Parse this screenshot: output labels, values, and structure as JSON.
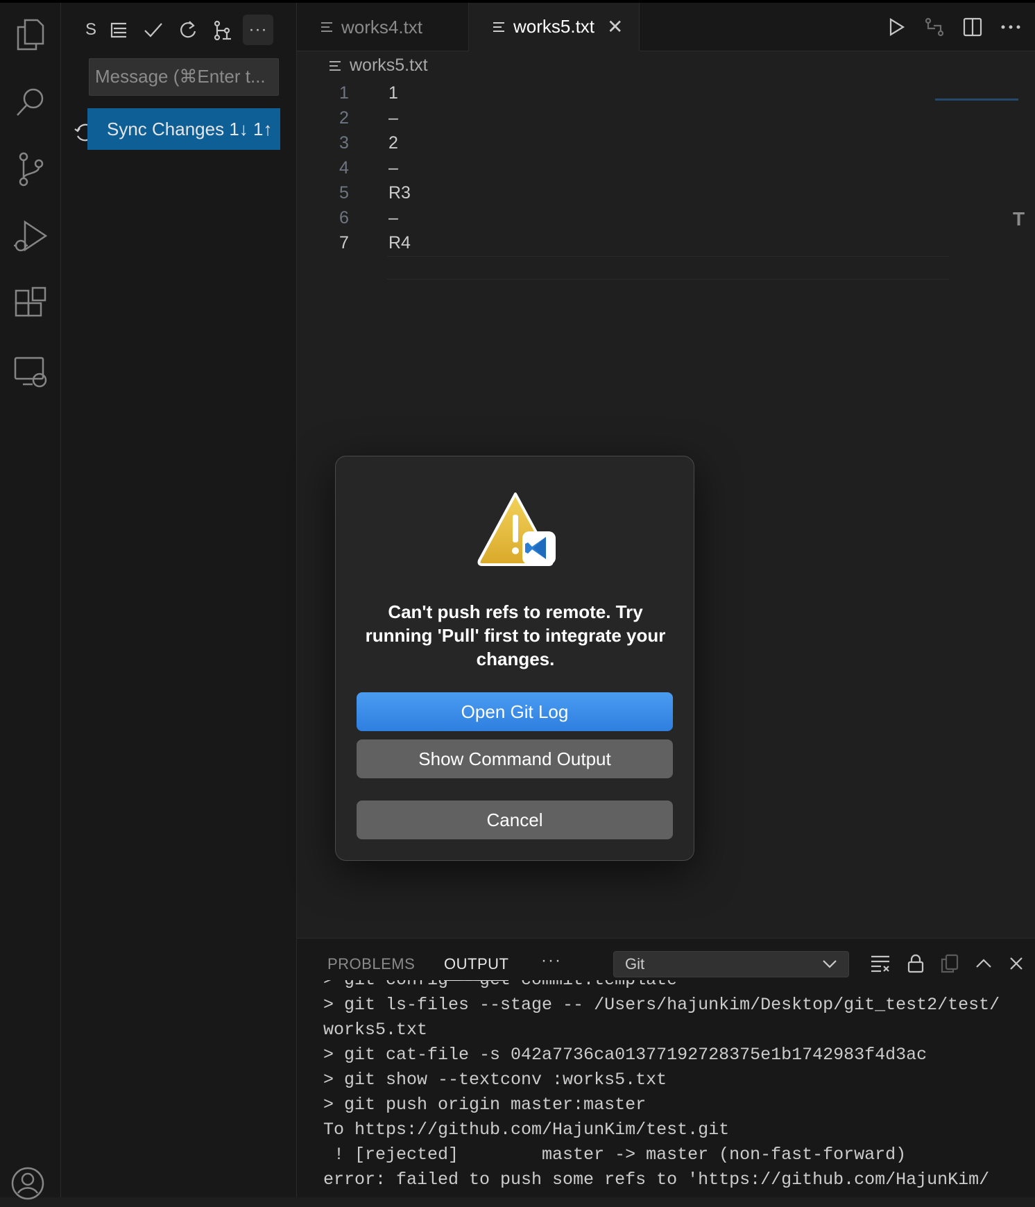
{
  "sidebar": {
    "title_short": "S",
    "commit_message_placeholder": "Message (⌘Enter t...",
    "sync_button_label": "Sync Changes 1↓ 1↑",
    "more_label": "···"
  },
  "tabs": [
    {
      "label": "works4.txt",
      "active": false
    },
    {
      "label": "works5.txt",
      "active": true
    }
  ],
  "editor": {
    "breadcrumb": "works5.txt",
    "lines": [
      {
        "num": "1",
        "text": "1"
      },
      {
        "num": "2",
        "text": "–"
      },
      {
        "num": "3",
        "text": "2"
      },
      {
        "num": "4",
        "text": "–"
      },
      {
        "num": "5",
        "text": "R3"
      },
      {
        "num": "6",
        "text": "–"
      },
      {
        "num": "7",
        "text": "R4"
      }
    ],
    "current_line": 7
  },
  "dialog": {
    "message": "Can't push refs to remote. Try running 'Pull' first to integrate your changes.",
    "buttons": {
      "primary": "Open Git Log",
      "secondary": "Show Command Output",
      "cancel": "Cancel"
    }
  },
  "panel": {
    "tabs": [
      "PROBLEMS",
      "OUTPUT"
    ],
    "active_tab": "OUTPUT",
    "more_label": "···",
    "channel": "Git",
    "output_lines": [
      "> git config --get commit.template",
      "> git ls-files --stage -- /Users/hajunkim/Desktop/git_test2/test/",
      "works5.txt",
      "> git cat-file -s 042a7736ca01377192728375e1b1742983f4d3ac",
      "> git show --textconv :works5.txt",
      "> git push origin master:master",
      "To https://github.com/HajunKim/test.git",
      " ! [rejected]        master -> master (non-fast-forward)",
      "error: failed to push some refs to 'https://github.com/HajunKim/"
    ]
  },
  "colors": {
    "accent": "#0e5f96",
    "dialog_primary": "#3b8ee8",
    "background": "#1e1e1e"
  }
}
